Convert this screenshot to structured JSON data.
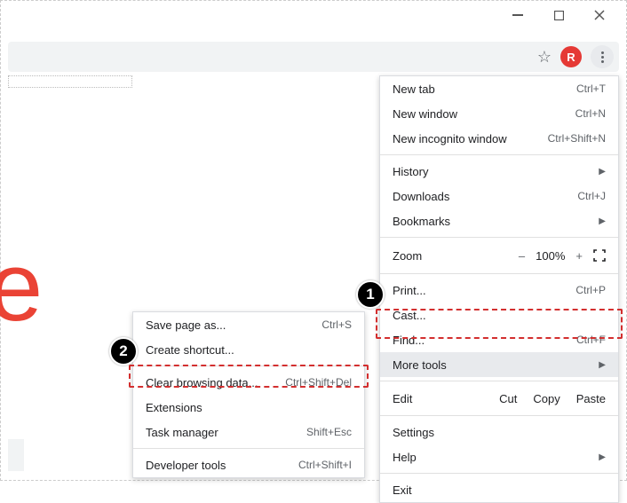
{
  "window": {
    "avatar_letter": "R"
  },
  "main_menu": {
    "new_tab": {
      "label": "New tab",
      "shortcut": "Ctrl+T"
    },
    "new_window": {
      "label": "New window",
      "shortcut": "Ctrl+N"
    },
    "new_incognito": {
      "label": "New incognito window",
      "shortcut": "Ctrl+Shift+N"
    },
    "history": {
      "label": "History"
    },
    "downloads": {
      "label": "Downloads",
      "shortcut": "Ctrl+J"
    },
    "bookmarks": {
      "label": "Bookmarks"
    },
    "zoom": {
      "label": "Zoom",
      "minus": "–",
      "value": "100%",
      "plus": "+"
    },
    "print": {
      "label": "Print...",
      "shortcut": "Ctrl+P"
    },
    "cast": {
      "label": "Cast..."
    },
    "find": {
      "label": "Find...",
      "shortcut": "Ctrl+F"
    },
    "more_tools": {
      "label": "More tools"
    },
    "edit": {
      "label": "Edit",
      "cut": "Cut",
      "copy": "Copy",
      "paste": "Paste"
    },
    "settings": {
      "label": "Settings"
    },
    "help": {
      "label": "Help"
    },
    "exit": {
      "label": "Exit"
    }
  },
  "submenu": {
    "save_page": {
      "label": "Save page as...",
      "shortcut": "Ctrl+S"
    },
    "create_shortcut": {
      "label": "Create shortcut..."
    },
    "clear_browsing": {
      "label": "Clear browsing data...",
      "shortcut": "Ctrl+Shift+Del"
    },
    "extensions": {
      "label": "Extensions"
    },
    "task_manager": {
      "label": "Task manager",
      "shortcut": "Shift+Esc"
    },
    "developer_tools": {
      "label": "Developer tools",
      "shortcut": "Ctrl+Shift+I"
    }
  },
  "callouts": {
    "one": "1",
    "two": "2"
  }
}
